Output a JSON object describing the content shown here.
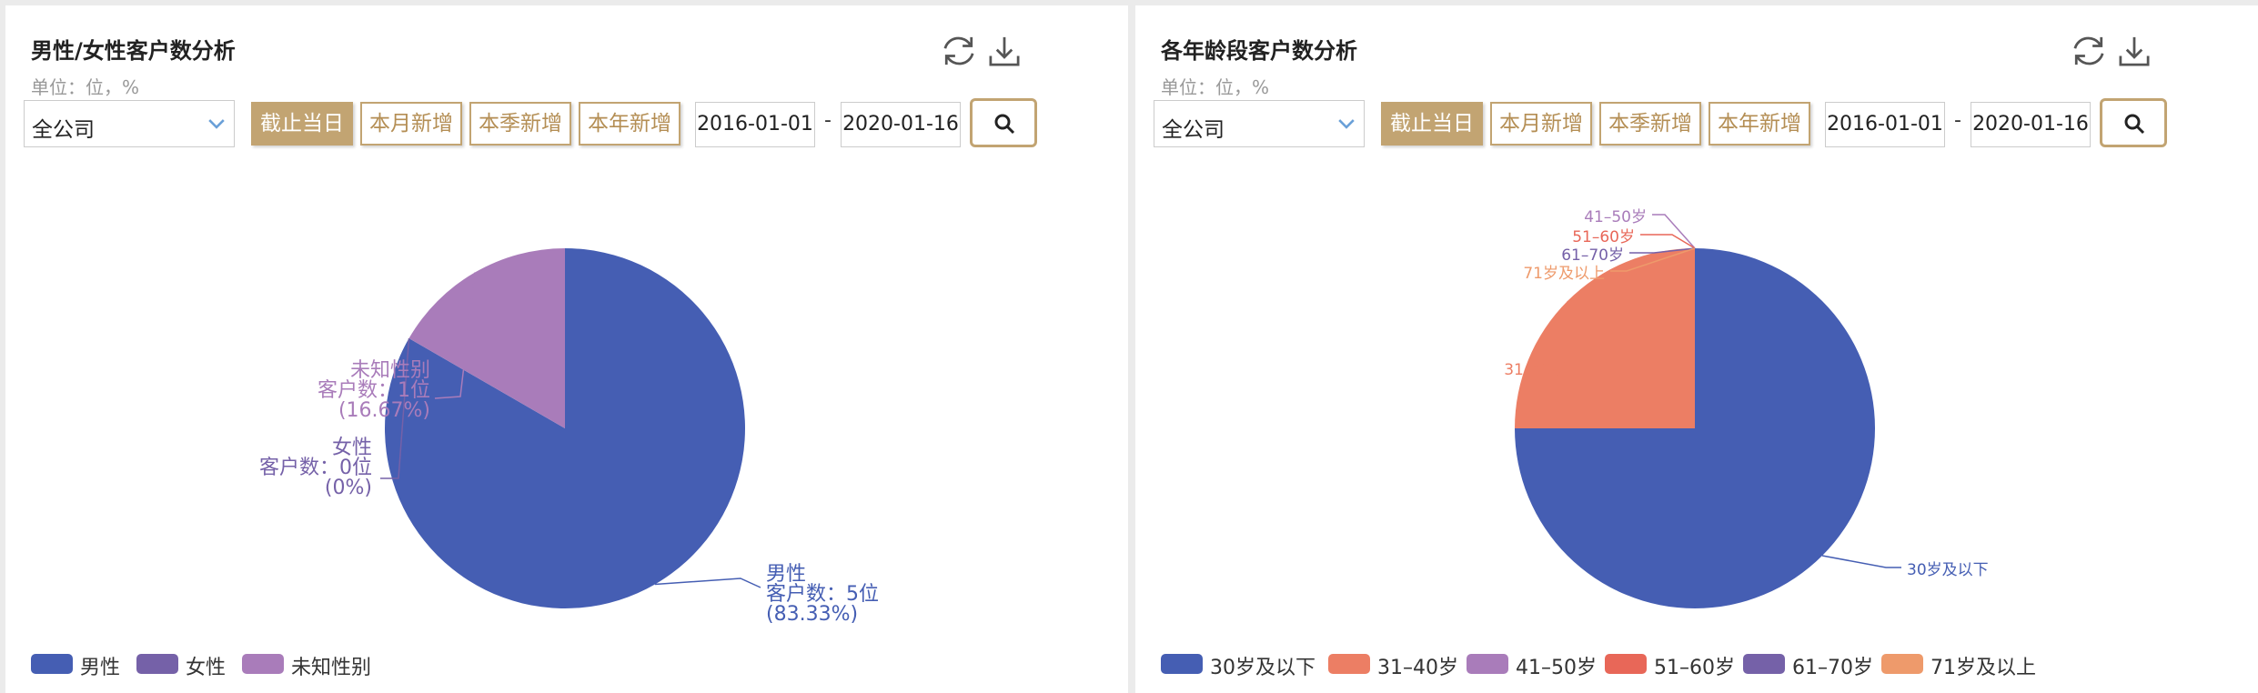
{
  "panels": [
    {
      "title": "男性/女性客户数分析",
      "unit": "单位：位，%",
      "company_select": "全公司",
      "buttons": [
        "截止当日",
        "本月新增",
        "本季新增",
        "本年新增"
      ],
      "active_button": 0,
      "date_from": "2016-01-01",
      "date_sep": "-",
      "date_to": "2020-01-16",
      "chart_data": {
        "type": "pie",
        "series": [
          {
            "name": "男性",
            "value": 5,
            "label": [
              "男性",
              "客户数：5位",
              "(83.33%)"
            ],
            "color": "#455eb3"
          },
          {
            "name": "女性",
            "value": 0,
            "label": [
              "女性",
              "客户数：0位",
              "(0%)"
            ],
            "color": "#7561a8"
          },
          {
            "name": "未知性别",
            "value": 1,
            "label": [
              "未知性别",
              "客户数：1位",
              "(16.67%)"
            ],
            "color": "#a97cba"
          }
        ],
        "legend": [
          "男性",
          "女性",
          "未知性别"
        ],
        "legend_position": "bottom-left"
      }
    },
    {
      "title": "各年龄段客户数分析",
      "unit": "单位：位，%",
      "company_select": "全公司",
      "buttons": [
        "截止当日",
        "本月新增",
        "本季新增",
        "本年新增"
      ],
      "active_button": 0,
      "date_from": "2016-01-01",
      "date_sep": "-",
      "date_to": "2020-01-16",
      "chart_data": {
        "type": "pie",
        "series": [
          {
            "name": "30岁及以下",
            "value": 3,
            "label": [
              "30岁及以下"
            ],
            "color": "#455eb3"
          },
          {
            "name": "31–40岁",
            "value": 1,
            "label": [
              "31–40岁"
            ],
            "color": "#ec7e64"
          },
          {
            "name": "41–50岁",
            "value": 0,
            "label": [
              "41–50岁"
            ],
            "color": "#a97cba"
          },
          {
            "name": "51–60岁",
            "value": 0,
            "label": [
              "51–60岁"
            ],
            "color": "#e86758"
          },
          {
            "name": "61–70岁",
            "value": 0,
            "label": [
              "61–70岁"
            ],
            "color": "#7561a8"
          },
          {
            "name": "71岁及以上",
            "value": 0,
            "label": [
              "71岁及以上"
            ],
            "color": "#ee9a6b"
          }
        ],
        "legend": [
          "30岁及以下",
          "31–40岁",
          "41–50岁",
          "51–60岁",
          "61–70岁",
          "71岁及以上"
        ],
        "legend_position": "bottom-left"
      }
    }
  ],
  "icons": {
    "refresh": "refresh-icon",
    "download": "download-icon",
    "search": "search-icon",
    "dropdown": "chevron-down-icon"
  }
}
